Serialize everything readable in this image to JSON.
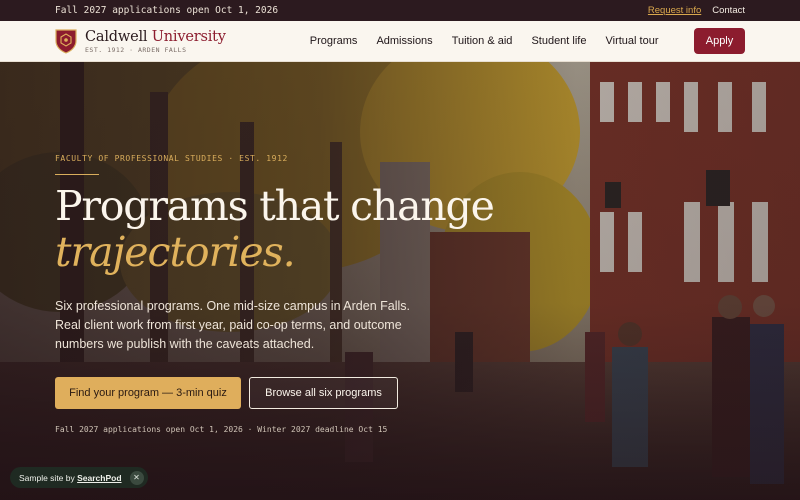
{
  "topbar": {
    "announcement": "Fall 2027 applications open Oct 1, 2026",
    "request_info": "Request info",
    "contact": "Contact"
  },
  "brand": {
    "name_part1": "Caldwell ",
    "name_part2": "University",
    "subline": "EST. 1912 · ARDEN FALLS"
  },
  "nav": {
    "items": [
      "Programs",
      "Admissions",
      "Tuition & aid",
      "Student life",
      "Virtual tour"
    ],
    "apply_label": "Apply"
  },
  "hero": {
    "eyebrow": "FACULTY OF PROFESSIONAL STUDIES · EST. 1912",
    "headline": "Programs that change",
    "headline_italic": "trajectories.",
    "lede": "Six professional programs. One mid-size campus in Arden Falls. Real client work from first year, paid co-op terms, and outcome numbers we publish with the caveats attached.",
    "primary_cta": "Find your program — 3-min quiz",
    "secondary_cta": "Browse all six programs",
    "deadlines": "Fall 2027 applications open Oct 1, 2026 · Winter 2027 deadline Oct 15"
  },
  "badge": {
    "prefix": "Sample site by ",
    "brand": "SearchPod",
    "close_icon": "close-icon"
  },
  "colors": {
    "brand_red": "#8c1c2e",
    "gold": "#dfae5c",
    "topbar_bg": "#2c1a1f",
    "nav_bg": "#faf6ef"
  }
}
